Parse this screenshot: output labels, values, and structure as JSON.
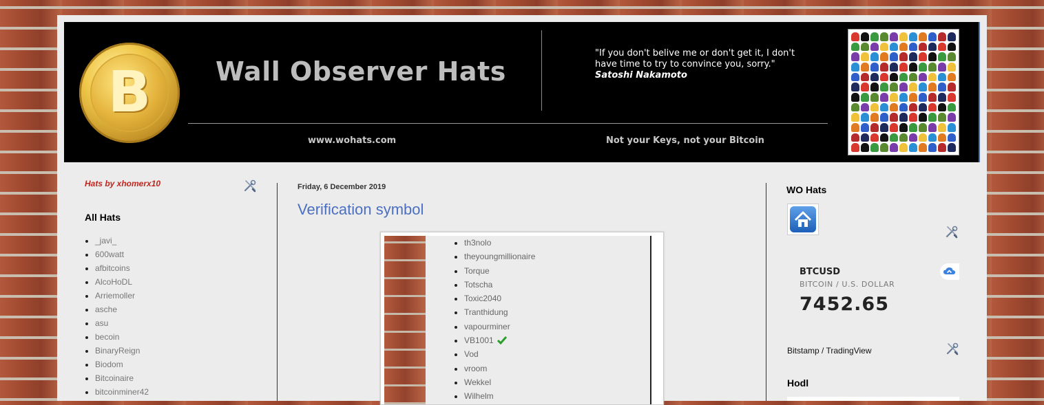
{
  "header": {
    "title": "Wall Observer Hats",
    "quote": "\"If you don't belive me or don't get it, I don't have time to try to convince you, sorry.\"",
    "quote_author": "Satoshi Nakamoto",
    "url": "www.wohats.com",
    "motto": "Not your Keys, not your Bitcoin",
    "coin_icon": "bitcoin-coin-icon"
  },
  "sidebar_left": {
    "hats_by": "Hats by xhomerx10",
    "section_title": "All Hats",
    "items": [
      "_javi_",
      "600watt",
      "afbitcoins",
      "AlcoHoDL",
      "Arriemoller",
      "asche",
      "asu",
      "becoin",
      "BinaryReign",
      "Biodom",
      "Bitcoinaire",
      "bitcoinminer42"
    ]
  },
  "post": {
    "date": "Friday, 6 December 2019",
    "title": "Verification symbol",
    "users": [
      "th3nolo",
      "theyoungmillionaire",
      "Torque",
      "Totscha",
      "Toxic2040",
      "Tranthidung",
      "vapourminer",
      "VB1001",
      "Vod",
      "vroom",
      "Wekkel",
      "Wilhelm"
    ],
    "verified_user": "VB1001"
  },
  "sidebar_right": {
    "title": "WO Hats",
    "home_icon": "home-icon",
    "ticker": {
      "symbol": "BTCUSD",
      "name": "BITCOIN / U.S. DOLLAR",
      "price": "7452.65",
      "source": "Bitstamp / TradingView"
    },
    "hodl_title": "Hodl"
  },
  "colors": {
    "title_link": "#4b6fc2",
    "hats_by": "#c0261e",
    "header_bg": "#000000",
    "verified_check": "#2a9d2a"
  }
}
